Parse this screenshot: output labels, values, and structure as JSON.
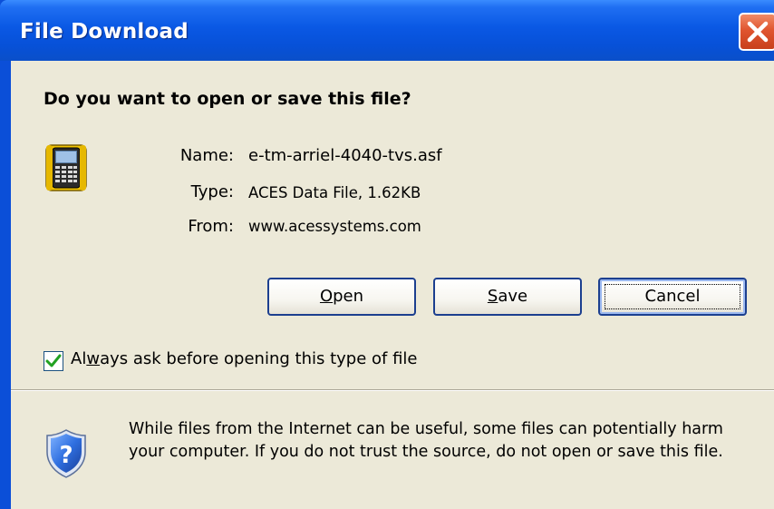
{
  "window": {
    "title": "File Download"
  },
  "dialog": {
    "question": "Do you want to open or save this file?",
    "file": {
      "name_label": "Name:",
      "name_value": "e-tm-arriel-4040-tvs.asf",
      "type_label": "Type:",
      "type_value": "ACES Data File, 1.62KB",
      "from_label": "From:",
      "from_value": "www.acessystems.com"
    },
    "buttons": {
      "open": {
        "mnemonic": "O",
        "rest": "pen"
      },
      "save": {
        "mnemonic": "S",
        "rest": "ave"
      },
      "cancel": "Cancel"
    },
    "always_ask": {
      "checked": true,
      "label_before": "Al",
      "label_mnemonic": "w",
      "label_after": "ays ask before opening this type of file"
    },
    "warning": {
      "line1": "While files from the Internet can be useful, some files can potentially harm",
      "line2": "your computer. If you do not trust the source, do not open or save this file."
    }
  },
  "icons": {
    "file": "pda-device-icon",
    "warning": "security-shield-icon",
    "close": "close-x-icon"
  },
  "colors": {
    "titlebar": "#0a58e4",
    "client_bg": "#ece9d8",
    "close_button": "#e0552f",
    "checkmark": "#21a121"
  }
}
